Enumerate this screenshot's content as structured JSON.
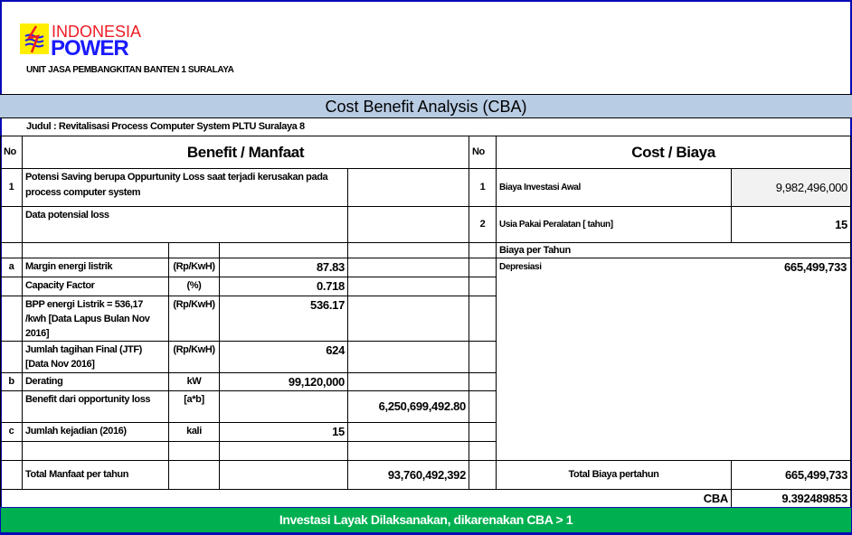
{
  "header": {
    "logo_text_top": "INDONESIA",
    "logo_text_bottom": "POWER",
    "unit": "UNIT JASA PEMBANGKITAN  BANTEN 1 SURALAYA",
    "title": "Cost Benefit Analysis (CBA)",
    "judul": "Judul :  Revitalisasi Process Computer System PLTU Suralaya 8"
  },
  "benefit": {
    "no_header": "No",
    "header": "Benefit / Manfaat",
    "rows": [
      {
        "no": "1",
        "label": "Potensi Saving berupa Oppurtunity Loss saat terjadi kerusakan pada process computer system"
      },
      {
        "label": "Data potensial loss"
      },
      {
        "no": "a",
        "label": "Margin energi listrik",
        "unit": "(Rp/KwH)",
        "value": "87.83"
      },
      {
        "label": "Capacity Factor",
        "unit": "(%)",
        "value": "0.718"
      },
      {
        "label": "BPP energi Listrik = 536,17 /kwh [Data Lapus Bulan Nov 2016]",
        "unit": "(Rp/KwH)",
        "value": "536.17"
      },
      {
        "label": "Jumlah tagihan Final (JTF) [Data Nov 2016]",
        "unit": "(Rp/KwH)",
        "value": "624"
      },
      {
        "no": "b",
        "label": "Derating",
        "unit": "kW",
        "value": "99,120,000"
      },
      {
        "label": "Benefit dari opportunity loss",
        "unit": "[a*b]",
        "total": "6,250,699,492.80"
      },
      {
        "no": "c",
        "label": "Jumlah kejadian (2016)",
        "unit": "kali",
        "value": "15"
      }
    ],
    "total_label": "Total Manfaat per tahun",
    "total_value": "93,760,492,392"
  },
  "cost": {
    "no_header": "No",
    "header": "Cost / Biaya",
    "rows": [
      {
        "no": "1",
        "label": "Biaya Investasi Awal",
        "value": "9,982,496,000"
      },
      {
        "no": "2",
        "label": "Usia Pakai Peralatan [ tahun]",
        "value": "15"
      }
    ],
    "per_year_label": "Biaya per Tahun",
    "depresiasi_label": "Depresiasi",
    "depresiasi_value": "665,499,733",
    "total_label": "Total Biaya pertahun",
    "total_value": "665,499,733"
  },
  "cba": {
    "label": "CBA",
    "value": "9.392489853"
  },
  "conclusion": "Investasi Layak Dilaksanakan, dikarenakan CBA > 1",
  "colors": {
    "title_band": "#b8cce4",
    "conclusion_bg": "#00b050",
    "input_cell_bg": "#f2f2f2",
    "frame": "#0a0ab4",
    "logo_red": "#ee1c25",
    "logo_blue": "#1a1aff",
    "logo_yellow": "#ffee00"
  }
}
